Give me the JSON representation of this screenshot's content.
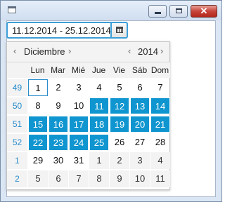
{
  "window": {
    "title": "",
    "icons": {
      "app": "window-icon",
      "minimize": "minimize-icon",
      "maximize": "maximize-icon",
      "close": "close-icon"
    },
    "close_glyph": "✕"
  },
  "date_field": {
    "value": "11.12.2014 - 25.12.2014",
    "button_icon": "calendar-icon"
  },
  "calendar": {
    "month": "Diciembre",
    "year": "2014",
    "prev_symbol": "‹",
    "next_symbol": "›",
    "weekdays": [
      "Lun",
      "Mar",
      "Mié",
      "Jue",
      "Vie",
      "Sáb",
      "Dom"
    ],
    "weeks": [
      {
        "number": "49",
        "days": [
          {
            "label": "1",
            "state": "today"
          },
          {
            "label": "2"
          },
          {
            "label": "3"
          },
          {
            "label": "4"
          },
          {
            "label": "5"
          },
          {
            "label": "6"
          },
          {
            "label": "7"
          }
        ]
      },
      {
        "number": "50",
        "days": [
          {
            "label": "8"
          },
          {
            "label": "9"
          },
          {
            "label": "10"
          },
          {
            "label": "11",
            "state": "selected"
          },
          {
            "label": "12",
            "state": "selected"
          },
          {
            "label": "13",
            "state": "selected"
          },
          {
            "label": "14",
            "state": "selected"
          }
        ]
      },
      {
        "number": "51",
        "days": [
          {
            "label": "15",
            "state": "selected"
          },
          {
            "label": "16",
            "state": "selected"
          },
          {
            "label": "17",
            "state": "selected"
          },
          {
            "label": "18",
            "state": "selected"
          },
          {
            "label": "19",
            "state": "selected"
          },
          {
            "label": "20",
            "state": "selected"
          },
          {
            "label": "21",
            "state": "selected"
          }
        ]
      },
      {
        "number": "52",
        "days": [
          {
            "label": "22",
            "state": "selected"
          },
          {
            "label": "23",
            "state": "selected"
          },
          {
            "label": "24",
            "state": "selected"
          },
          {
            "label": "25",
            "state": "selected"
          },
          {
            "label": "26"
          },
          {
            "label": "27"
          },
          {
            "label": "28"
          }
        ]
      },
      {
        "number": "1",
        "days": [
          {
            "label": "29"
          },
          {
            "label": "30"
          },
          {
            "label": "31"
          },
          {
            "label": "1",
            "state": "other"
          },
          {
            "label": "2",
            "state": "other"
          },
          {
            "label": "3",
            "state": "other"
          },
          {
            "label": "4",
            "state": "other"
          }
        ]
      },
      {
        "number": "2",
        "days": [
          {
            "label": "5",
            "state": "other"
          },
          {
            "label": "6",
            "state": "other"
          },
          {
            "label": "7",
            "state": "other"
          },
          {
            "label": "8",
            "state": "other"
          },
          {
            "label": "9",
            "state": "other"
          },
          {
            "label": "10",
            "state": "other"
          },
          {
            "label": "11",
            "state": "other"
          }
        ]
      }
    ]
  },
  "colors": {
    "selection": "#0f95cf",
    "week_number": "#2a8ccc",
    "focus_border": "#3c9ed7"
  }
}
